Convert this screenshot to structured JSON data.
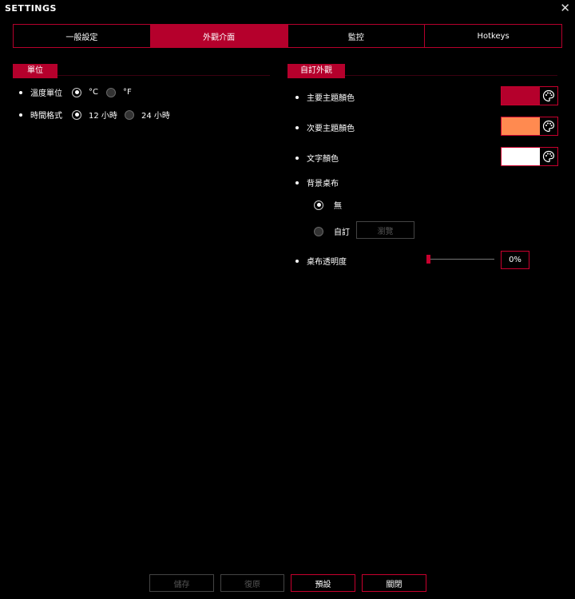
{
  "window": {
    "title": "SETTINGS",
    "close_glyph": "✕"
  },
  "tabs": [
    {
      "label": "一般設定",
      "active": false
    },
    {
      "label": "外觀介面",
      "active": true
    },
    {
      "label": "監控",
      "active": false
    },
    {
      "label": "Hotkeys",
      "active": false
    }
  ],
  "units": {
    "header": "單位",
    "temperature": {
      "label": "溫度單位",
      "option_c": "°C",
      "option_f": "°F",
      "selected": "°C"
    },
    "time": {
      "label": "時間格式",
      "option_12": "12 小時",
      "option_24": "24 小時",
      "selected": "12 小時"
    }
  },
  "appearance": {
    "header": "自訂外觀",
    "primary": {
      "label": "主要主題顏色",
      "color": "#b5002c"
    },
    "secondary": {
      "label": "次要主題顏色",
      "color": "#ff8a50"
    },
    "text": {
      "label": "文字顏色",
      "color": "#ffffff"
    },
    "wallpaper": {
      "label": "背景桌布",
      "none": "無",
      "custom": "自訂",
      "browse": "瀏覽",
      "selected": "無"
    },
    "opacity": {
      "label": "桌布透明度",
      "value_text": "0%",
      "value": 0
    }
  },
  "footer": {
    "save": "儲存",
    "restore": "復原",
    "default": "預設",
    "close": "關閉"
  },
  "colors": {
    "accent": "#b5002c",
    "background": "#000000"
  }
}
